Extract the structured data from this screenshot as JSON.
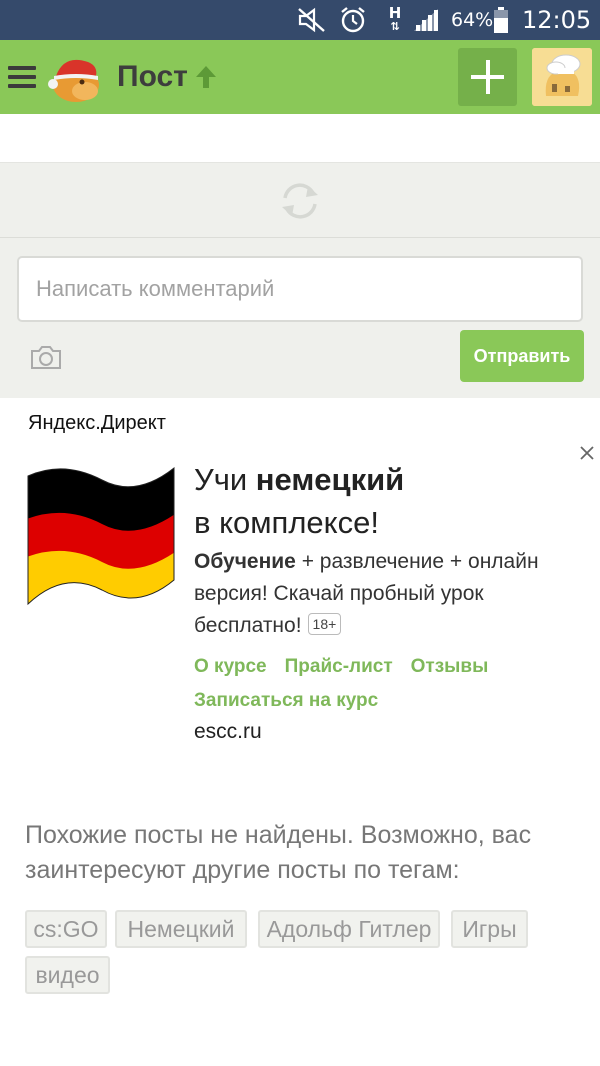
{
  "status_bar": {
    "battery_percent": "64%",
    "time": "12:05",
    "network": "H",
    "icons": [
      "mute-icon",
      "alarm-icon",
      "network-h-icon",
      "signal-icon",
      "battery-icon"
    ]
  },
  "app_bar": {
    "title": "Пост",
    "icons": [
      "menu-icon",
      "logo-icon",
      "up-arrow-icon",
      "plus-icon",
      "avatar-icon"
    ],
    "accent_color": "#8ac858"
  },
  "loader": {
    "icon": "refresh-icon"
  },
  "comment": {
    "placeholder": "Написать комментарий",
    "send_label": "Отправить",
    "camera_icon": "camera-icon"
  },
  "ad": {
    "label": "Яндекс.Директ",
    "title_plain_1": "Учи ",
    "title_bold": "немецкий",
    "title_plain_2": "в комплексе!",
    "desc_bold": "Обучение",
    "desc_rest": " + развлечение + онлайн версия! Скачай пробный урок бесплатно!",
    "age": "18+",
    "links": [
      "О курсе",
      "Прайс-лист",
      "Отзывы",
      "Записаться на курс"
    ],
    "domain": "escc.ru",
    "link_color": "#7fb85a"
  },
  "similar": {
    "text": "Похожие посты не найдены. Возможно, вас заинтересуют другие посты по тегам:",
    "tags": [
      "cs:GO",
      "Немецкий",
      "Адольф Гитлер",
      "Игры",
      "видео"
    ]
  }
}
